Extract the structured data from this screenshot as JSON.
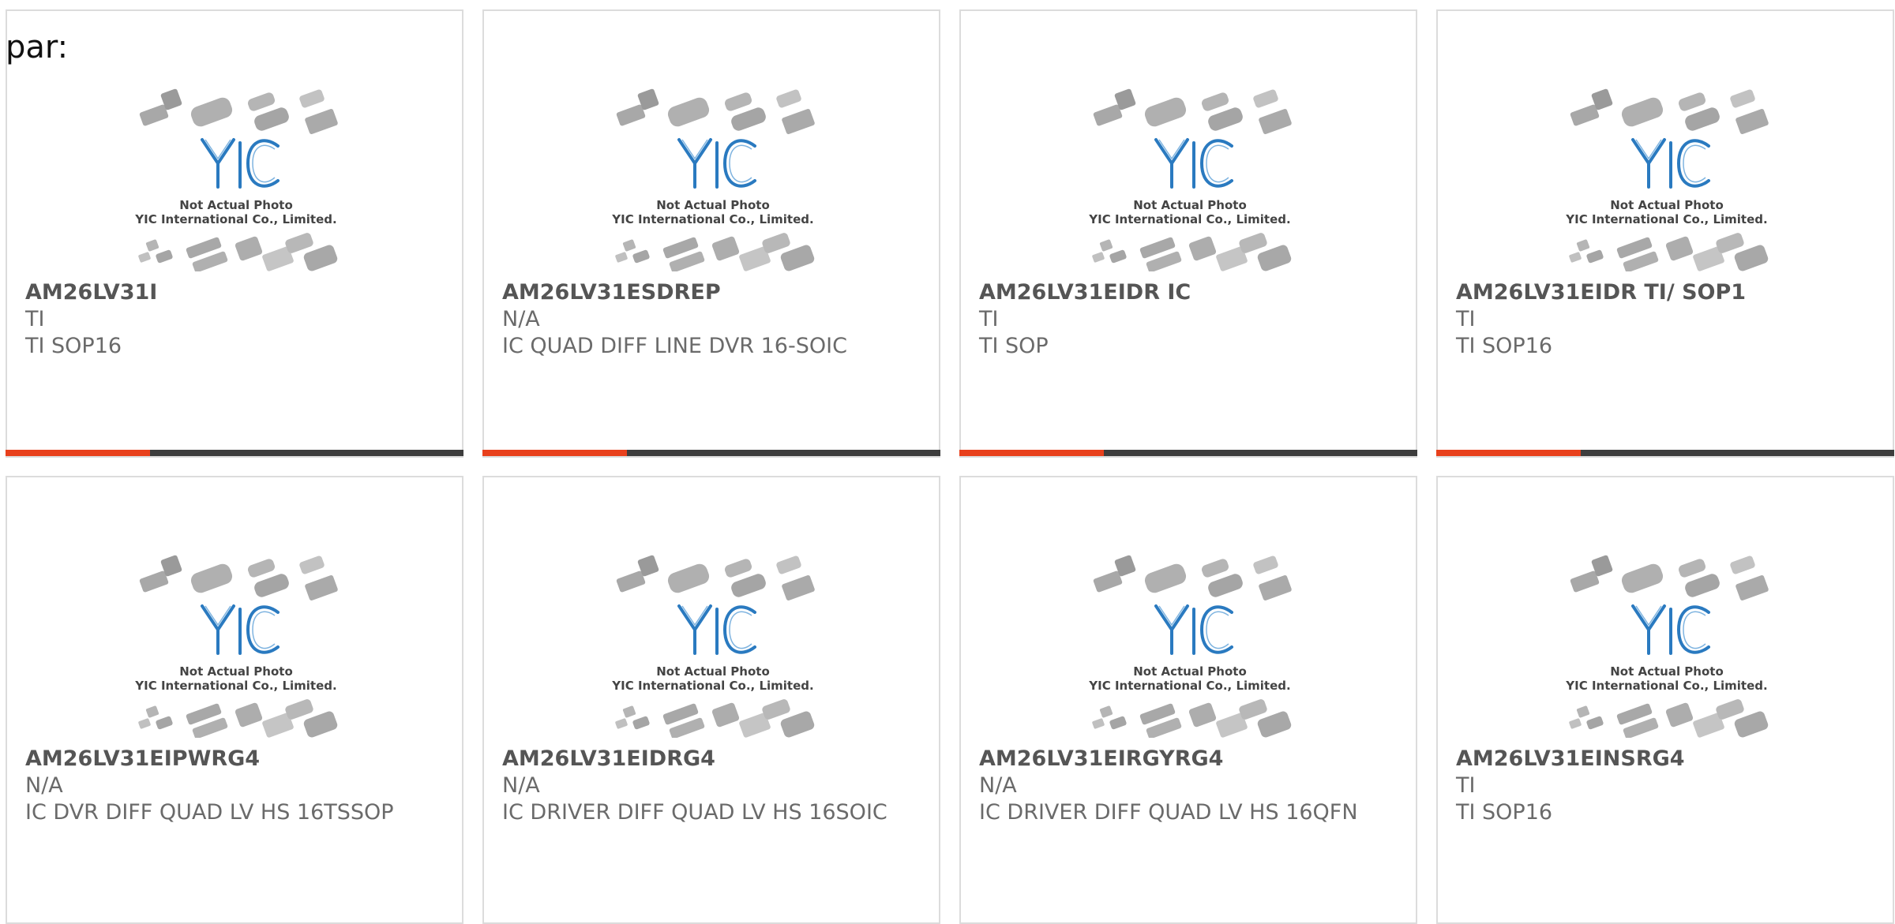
{
  "page_label": "par:",
  "accent_color": "#e8401c",
  "bar_color": "#3d3d3d",
  "image_caption": {
    "line1": "Not Actual Photo",
    "line2": "YIC International Co., Limited.",
    "logo": "YIC"
  },
  "products": [
    {
      "part": "AM26LV31I",
      "brand": "TI",
      "desc": "TI SOP16",
      "highlighted": true
    },
    {
      "part": "AM26LV31ESDREP",
      "brand": "N/A",
      "desc": "IC QUAD DIFF LINE DVR 16-SOIC",
      "highlighted": true
    },
    {
      "part": "AM26LV31EIDR IC",
      "brand": "TI",
      "desc": "TI SOP",
      "highlighted": true
    },
    {
      "part": "AM26LV31EIDR TI/ SOP1",
      "brand": "TI",
      "desc": "TI SOP16",
      "highlighted": true
    },
    {
      "part": "AM26LV31EIPWRG4",
      "brand": "N/A",
      "desc": "IC DVR DIFF QUAD LV HS 16TSSOP",
      "highlighted": false
    },
    {
      "part": "AM26LV31EIDRG4",
      "brand": "N/A",
      "desc": "IC DRIVER DIFF QUAD LV HS 16SOIC",
      "highlighted": false
    },
    {
      "part": "AM26LV31EIRGYRG4",
      "brand": "N/A",
      "desc": "IC DRIVER DIFF QUAD LV HS 16QFN",
      "highlighted": false
    },
    {
      "part": "AM26LV31EINSRG4",
      "brand": "TI",
      "desc": "TI SOP16",
      "highlighted": false
    }
  ]
}
